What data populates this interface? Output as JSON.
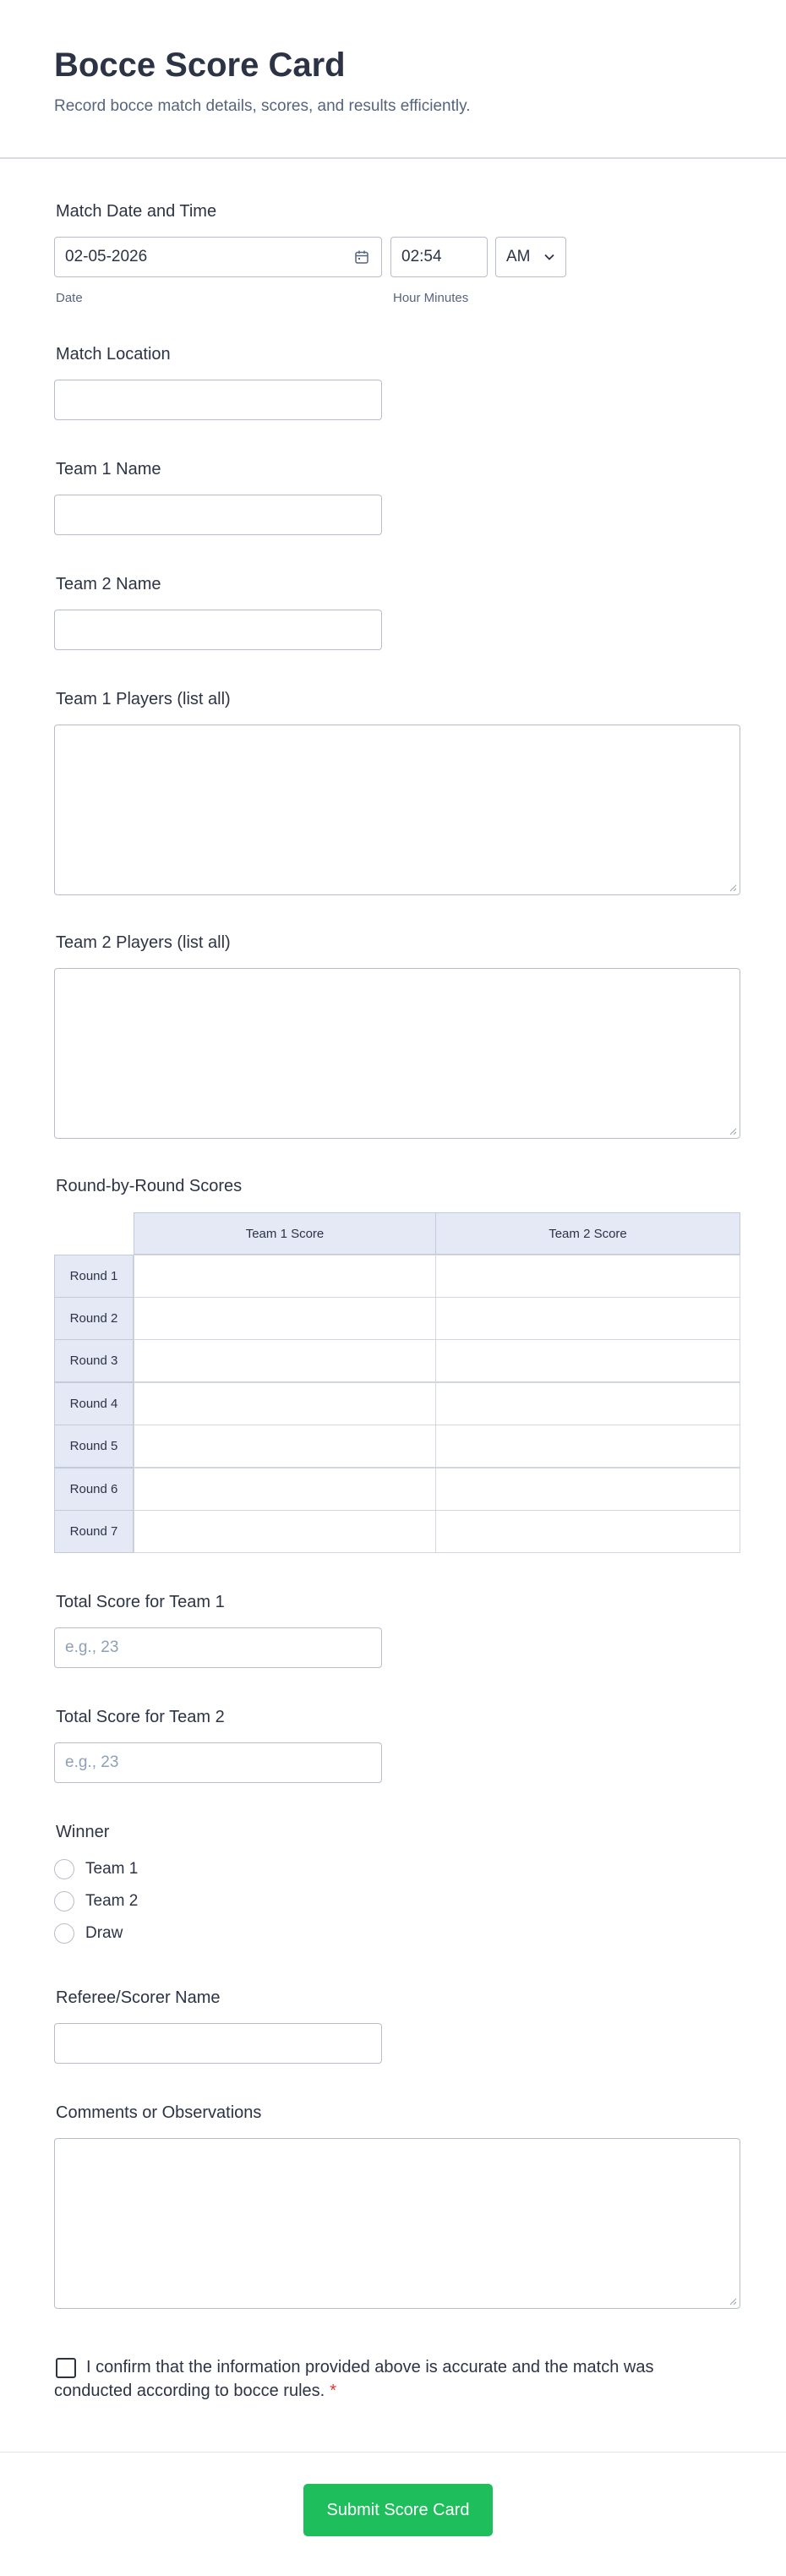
{
  "form": {
    "title": "Bocce Score Card",
    "description": "Record bocce match details, scores, and results efficiently."
  },
  "match_datetime": {
    "label": "Match Date and Time",
    "date_value": "02-05-2026",
    "date_sublabel": "Date",
    "time_value": "02:54",
    "time_sublabel": "Hour Minutes",
    "ampm_value": "AM",
    "calendar_icon": "calendar-icon",
    "chevron_icon": "chevron-down-icon"
  },
  "match_location": {
    "label": "Match Location",
    "value": ""
  },
  "team1_name": {
    "label": "Team 1 Name",
    "value": ""
  },
  "team2_name": {
    "label": "Team 2 Name",
    "value": ""
  },
  "team1_players": {
    "label": "Team 1 Players (list all)",
    "value": ""
  },
  "team2_players": {
    "label": "Team 2 Players (list all)",
    "value": ""
  },
  "round_scores": {
    "label": "Round-by-Round Scores",
    "columns": [
      "Team 1 Score",
      "Team 2 Score"
    ],
    "rows": [
      "Round 1",
      "Round 2",
      "Round 3",
      "Round 4",
      "Round 5",
      "Round 6",
      "Round 7"
    ]
  },
  "total_team1": {
    "label": "Total Score for Team 1",
    "placeholder": "e.g., 23"
  },
  "total_team2": {
    "label": "Total Score for Team 2",
    "placeholder": "e.g., 23"
  },
  "winner": {
    "label": "Winner",
    "options": [
      "Team 1",
      "Team 2",
      "Draw"
    ]
  },
  "referee": {
    "label": "Referee/Scorer Name",
    "value": ""
  },
  "comments": {
    "label": "Comments or Observations",
    "value": ""
  },
  "confirm": {
    "text": "I confirm that the information provided above is accurate and the match was conducted according to bocce rules.",
    "required_marker": "*"
  },
  "submit": {
    "label": "Submit Score Card"
  },
  "colors": {
    "accent": "#1fbe5c",
    "text": "#2c3345",
    "required": "#e5322d",
    "table_header_bg": "#e5e9f5"
  }
}
